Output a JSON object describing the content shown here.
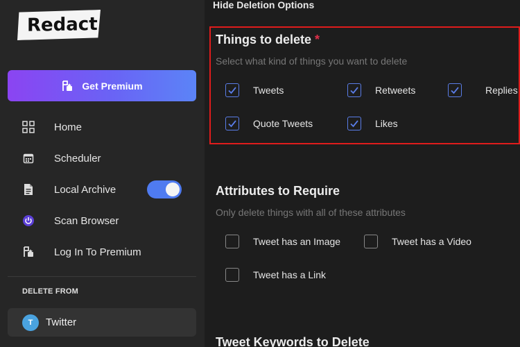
{
  "sidebar": {
    "logo_text": "Redact",
    "premium_label": "Get Premium",
    "nav": [
      {
        "label": "Home",
        "icon": "grid-icon"
      },
      {
        "label": "Scheduler",
        "icon": "calendar-icon"
      },
      {
        "label": "Local Archive",
        "icon": "document-icon"
      },
      {
        "label": "Scan Browser",
        "icon": "power-icon"
      },
      {
        "label": "Log In To Premium",
        "icon": "premium-icon"
      }
    ],
    "local_archive_toggle": "on",
    "delete_from_label": "DELETE FROM",
    "account": {
      "avatar_letter": "T",
      "name": "Twitter"
    }
  },
  "main": {
    "hide_options_label": "Hide Deletion Options",
    "things": {
      "title": "Things to delete",
      "required_mark": "*",
      "subtitle": "Select what kind of things you want to delete",
      "options": [
        {
          "label": "Tweets",
          "checked": true
        },
        {
          "label": "Retweets",
          "checked": true
        },
        {
          "label": "Replies",
          "checked": true
        },
        {
          "label": "Quote Tweets",
          "checked": true
        },
        {
          "label": "Likes",
          "checked": true
        }
      ]
    },
    "attributes": {
      "title": "Attributes to Require",
      "subtitle": "Only delete things with all of these attributes",
      "options": [
        {
          "label": "Tweet has an Image",
          "checked": false
        },
        {
          "label": "Tweet has a Video",
          "checked": false
        },
        {
          "label": "Tweet has a Link",
          "checked": false
        }
      ]
    },
    "keywords_title": "Tweet Keywords to Delete"
  },
  "colors": {
    "accent": "#5a7de8",
    "highlight_border": "#e01c1c",
    "required": "#e0304a",
    "premium_gradient_start": "#8b44f2",
    "premium_gradient_end": "#5b84f7"
  }
}
